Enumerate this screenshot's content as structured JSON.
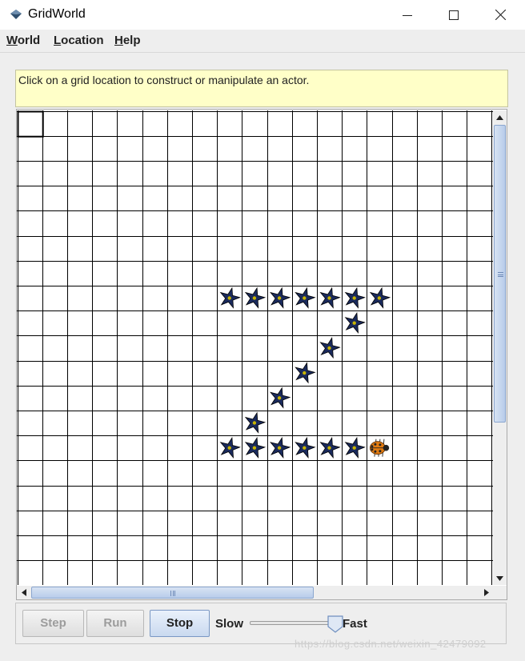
{
  "window": {
    "title": "GridWorld",
    "icon": "gridworld-diamond-icon"
  },
  "menu": {
    "items": [
      {
        "mnemonic": "W",
        "rest": "orld"
      },
      {
        "mnemonic": "L",
        "rest": "ocation"
      },
      {
        "mnemonic": "H",
        "rest": "elp"
      }
    ]
  },
  "message": "Click on a grid location to construct or manipulate an actor.",
  "grid": {
    "rows": 19,
    "cols": 19,
    "selected_cell": {
      "row": 0,
      "col": 0
    },
    "flowers": [
      {
        "row": 7,
        "col": 8
      },
      {
        "row": 7,
        "col": 9
      },
      {
        "row": 7,
        "col": 10
      },
      {
        "row": 7,
        "col": 11
      },
      {
        "row": 7,
        "col": 12
      },
      {
        "row": 7,
        "col": 13
      },
      {
        "row": 7,
        "col": 14
      },
      {
        "row": 8,
        "col": 13
      },
      {
        "row": 9,
        "col": 12
      },
      {
        "row": 10,
        "col": 11
      },
      {
        "row": 11,
        "col": 10
      },
      {
        "row": 12,
        "col": 9
      },
      {
        "row": 13,
        "col": 8
      },
      {
        "row": 13,
        "col": 9
      },
      {
        "row": 13,
        "col": 10
      },
      {
        "row": 13,
        "col": 11
      },
      {
        "row": 13,
        "col": 12
      },
      {
        "row": 13,
        "col": 13
      }
    ],
    "bug": {
      "row": 13,
      "col": 14
    },
    "colors": {
      "flower": "#1a2a5c",
      "flower_center": "#c8b400",
      "bug": "#e07a10"
    }
  },
  "controls": {
    "step_label": "Step",
    "run_label": "Run",
    "stop_label": "Stop",
    "slow_label": "Slow",
    "fast_label": "Fast",
    "speed_fraction": 0.9
  },
  "watermark": "https://blog.csdn.net/weixin_42479092"
}
